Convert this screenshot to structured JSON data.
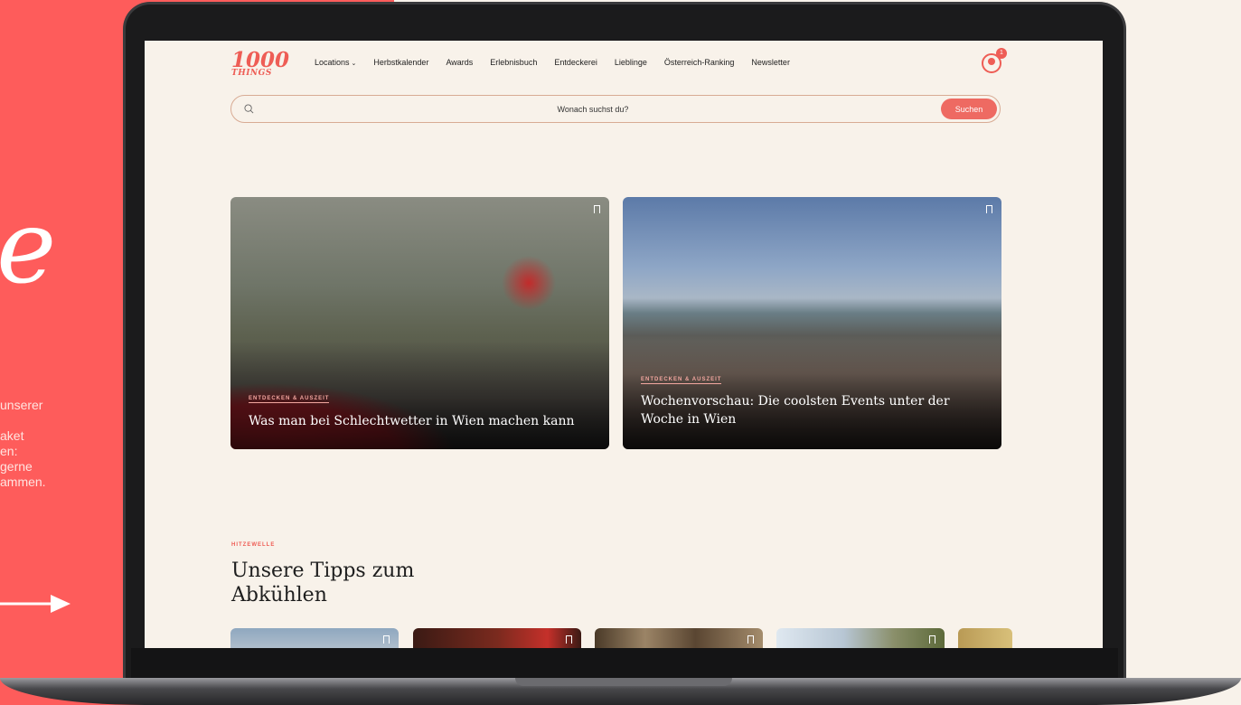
{
  "promo": {
    "letter": "e",
    "text": "unserer\n\naket\nen:\ngerne\nammen."
  },
  "site": {
    "logo_number": "1000",
    "logo_word": "THINGS",
    "nav": [
      "Locations",
      "Herbstkalender",
      "Awards",
      "Erlebnisbuch",
      "Entdeckerei",
      "Lieblinge",
      "Österreich-Ranking",
      "Newsletter"
    ],
    "notification_count": "1"
  },
  "search": {
    "placeholder": "Wonach suchst du?",
    "button": "Suchen"
  },
  "featured": [
    {
      "tag": "ENTDECKEN & AUSZEIT",
      "title": "Was man bei Schlechtwetter in Wien machen kann"
    },
    {
      "tag": "ENTDECKEN & AUSZEIT",
      "title": "Wochenvorschau: Die coolsten Events unter der Woche in Wien"
    }
  ],
  "section": {
    "kicker": "HITZEWELLE",
    "title": "Unsere Tipps zum Abkühlen"
  },
  "colors": {
    "accent": "#ee5d55",
    "promo_bg": "#fe5c5b",
    "page_bg": "#f8f2ea"
  }
}
